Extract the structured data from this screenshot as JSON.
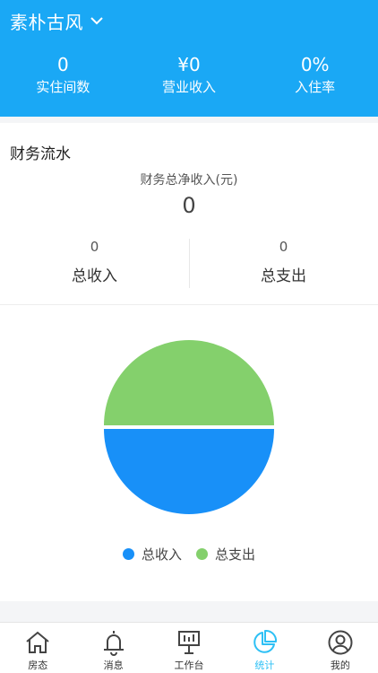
{
  "header": {
    "hotel_name": "素朴古风",
    "stats": [
      {
        "value": "0",
        "label": "实住间数"
      },
      {
        "value": "¥0",
        "label": "营业收入"
      },
      {
        "value": "0%",
        "label": "入住率"
      }
    ]
  },
  "finance": {
    "title": "财务流水",
    "net_label": "财务总净收入(元)",
    "net_value": "0",
    "income": {
      "value": "0",
      "label": "总收入"
    },
    "expense": {
      "value": "0",
      "label": "总支出"
    }
  },
  "chart_data": {
    "type": "pie",
    "categories": [
      "总收入",
      "总支出"
    ],
    "values": [
      0,
      0
    ],
    "colors": [
      "#1890f8",
      "#84d06c"
    ],
    "legend": "bottom"
  },
  "tabs": [
    {
      "label": "房态",
      "icon": "home-icon"
    },
    {
      "label": "消息",
      "icon": "bell-icon"
    },
    {
      "label": "工作台",
      "icon": "workbench-icon"
    },
    {
      "label": "统计",
      "icon": "pie-chart-icon",
      "active": true
    },
    {
      "label": "我的",
      "icon": "user-icon"
    }
  ]
}
